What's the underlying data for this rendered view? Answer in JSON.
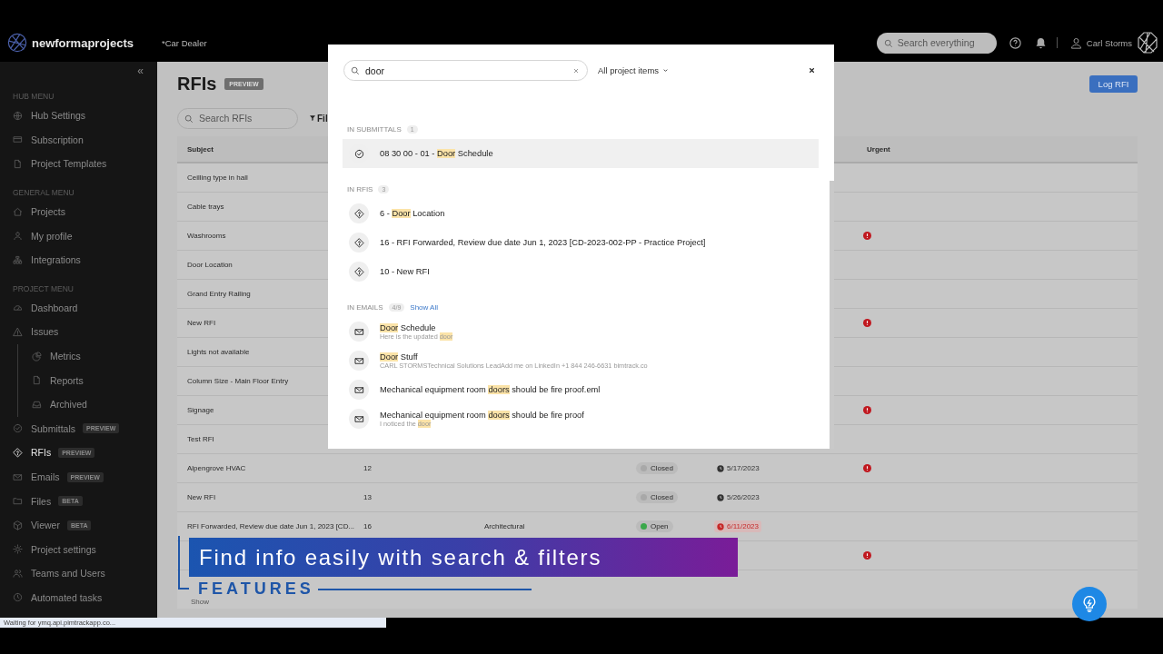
{
  "top_bar": {
    "logo_text": "newformaprojects",
    "project": "*Car Dealer",
    "search": {
      "placeholder": "Search everything"
    },
    "user_name": "Carl Storms"
  },
  "sidebar": {
    "collapse_glyph": "«",
    "sections": [
      {
        "title": "HUB MENU",
        "items": [
          {
            "label": "Hub Settings",
            "kind": "globe",
            "selected": false
          },
          {
            "label": "Subscription",
            "kind": "card",
            "selected": false
          },
          {
            "label": "Project Templates",
            "kind": "file",
            "selected": false
          }
        ]
      },
      {
        "title": "GENERAL MENU",
        "items": [
          {
            "label": "Projects",
            "kind": "home",
            "selected": false
          },
          {
            "label": "My profile",
            "kind": "person",
            "selected": false
          },
          {
            "label": "Integrations",
            "kind": "network",
            "selected": false
          }
        ]
      },
      {
        "title": "PROJECT MENU",
        "items": [
          {
            "label": "Dashboard",
            "kind": "gauge",
            "selected": false
          },
          {
            "label": "Issues",
            "kind": "warning",
            "selected": false,
            "children": [
              {
                "label": "Metrics",
                "kind": "pie",
                "selected": false
              },
              {
                "label": "Reports",
                "kind": "file",
                "selected": false
              },
              {
                "label": "Archived",
                "kind": "inbox",
                "selected": false
              }
            ]
          },
          {
            "label": "Submittals",
            "kind": "check",
            "selected": false,
            "badge": "PREVIEW"
          },
          {
            "label": "RFIs",
            "kind": "diamond",
            "selected": true,
            "badge": "PREVIEW"
          },
          {
            "label": "Emails",
            "kind": "mail",
            "selected": false,
            "badge": "PREVIEW"
          },
          {
            "label": "Files",
            "kind": "folder",
            "selected": false,
            "badge": "BETA"
          },
          {
            "label": "Viewer",
            "kind": "cube",
            "selected": false,
            "badge": "BETA"
          },
          {
            "label": "Project settings",
            "kind": "gear",
            "selected": false
          },
          {
            "label": "Teams and Users",
            "kind": "people",
            "selected": false
          },
          {
            "label": "Automated tasks",
            "kind": "clock",
            "selected": false
          }
        ]
      }
    ]
  },
  "page": {
    "title": "RFIs",
    "badge": "PREVIEW",
    "log_button": "Log RFI",
    "search": {
      "placeholder": "Search RFIs"
    },
    "filter_button": "Fil"
  },
  "table": {
    "columns": [
      {
        "label": "Subject"
      },
      {
        "label": "Urgent"
      }
    ],
    "rows": [
      {
        "subject": "Ceilling type in hall",
        "urgent": false
      },
      {
        "subject": "Cable trays",
        "urgent": false
      },
      {
        "subject": "Washrooms",
        "urgent": true
      },
      {
        "subject": "Door Location",
        "urgent": false
      },
      {
        "subject": "Grand Entry Railing",
        "urgent": false
      },
      {
        "subject": "New RFI",
        "urgent": true
      },
      {
        "subject": "Lights not available",
        "urgent": false
      },
      {
        "subject": "Column Size - Main Floor Entry",
        "urgent": false
      },
      {
        "subject": "Signage",
        "urgent": true
      },
      {
        "subject": "Test RFI",
        "urgent": false
      },
      {
        "subject": "Alpengrove HVAC",
        "column_2": "12",
        "status": {
          "label": "Closed",
          "color": "#a8a8a8"
        },
        "date": {
          "text": "5/17/2023",
          "overdue": false
        },
        "urgent": true
      },
      {
        "subject": "New RFI",
        "column_2": "13",
        "status": {
          "label": "Closed",
          "color": "#a8a8a8"
        },
        "date": {
          "text": "5/26/2023",
          "overdue": false
        },
        "urgent": false
      },
      {
        "subject": "RFI Forwarded, Review due date Jun 1, 2023 [CD...",
        "column_2": "16",
        "column_3": "Architectural",
        "status": {
          "label": "Open",
          "color": "#3aa84a"
        },
        "date": {
          "text": "6/11/2023",
          "overdue": true
        },
        "urgent": false
      },
      {
        "urgent": true
      }
    ],
    "pagination": {
      "show_label": "Show"
    }
  },
  "search_modal": {
    "query": "door",
    "scope": "All project items",
    "sections": [
      {
        "title": "IN SUBMITTALS",
        "count": "1",
        "items": [
          {
            "kind": "check",
            "hovered": true,
            "title": [
              {
                "text": "08 30 00 - 01 - ",
                "highlight": false
              },
              {
                "text": "Door",
                "highlight": true
              },
              {
                "text": " Schedule",
                "highlight": false
              }
            ]
          }
        ]
      },
      {
        "title": "IN RFIS",
        "count": "3",
        "items": [
          {
            "kind": "diamond",
            "hovered": false,
            "title": [
              {
                "text": "6 - ",
                "highlight": false
              },
              {
                "text": "Door",
                "highlight": true
              },
              {
                "text": " Location",
                "highlight": false
              }
            ]
          },
          {
            "kind": "diamond",
            "hovered": false,
            "title": [
              {
                "text": "16 - RFI Forwarded, Review due date Jun 1, 2023 [CD-2023-002-PP - Practice Project]",
                "highlight": false
              }
            ]
          },
          {
            "kind": "diamond",
            "hovered": false,
            "title": [
              {
                "text": "10 - New RFI",
                "highlight": false
              }
            ]
          }
        ]
      },
      {
        "title": "IN EMAILS",
        "count": "4/9",
        "link": "Show All",
        "items": [
          {
            "kind": "mail",
            "hovered": false,
            "title": [
              {
                "text": "Door",
                "highlight": true
              },
              {
                "text": " Schedule",
                "highlight": false
              }
            ],
            "snippet": [
              {
                "text": "Here is the updated ",
                "highlight": false
              },
              {
                "text": "door",
                "highlight": true
              }
            ]
          },
          {
            "kind": "mail",
            "hovered": false,
            "title": [
              {
                "text": "Door",
                "highlight": true
              },
              {
                "text": " Stuff",
                "highlight": false
              }
            ],
            "snippet": [
              {
                "text": "CARL STORMSTechnical Solutions LeadAdd me on LinkedIn +1 844 246-6631 bimtrack.co",
                "highlight": false
              }
            ]
          },
          {
            "kind": "mail",
            "hovered": false,
            "title": [
              {
                "text": "Mechanical equipment room ",
                "highlight": false
              },
              {
                "text": "doors",
                "highlight": true
              },
              {
                "text": " should be fire proof.eml",
                "highlight": false
              }
            ]
          },
          {
            "kind": "mail",
            "hovered": false,
            "title": [
              {
                "text": "Mechanical equipment room ",
                "highlight": false
              },
              {
                "text": "doors",
                "highlight": true
              },
              {
                "text": " should be fire proof",
                "highlight": false
              }
            ],
            "snippet": [
              {
                "text": "I noticed the ",
                "highlight": false
              },
              {
                "text": "door",
                "highlight": true
              }
            ]
          }
        ]
      }
    ]
  },
  "video_banner": {
    "headline": "Find info easily with search & filters",
    "label": "FEATURES"
  },
  "status_bar": {
    "text": "Waiting for ymq.api.pimtrackapp.co..."
  }
}
